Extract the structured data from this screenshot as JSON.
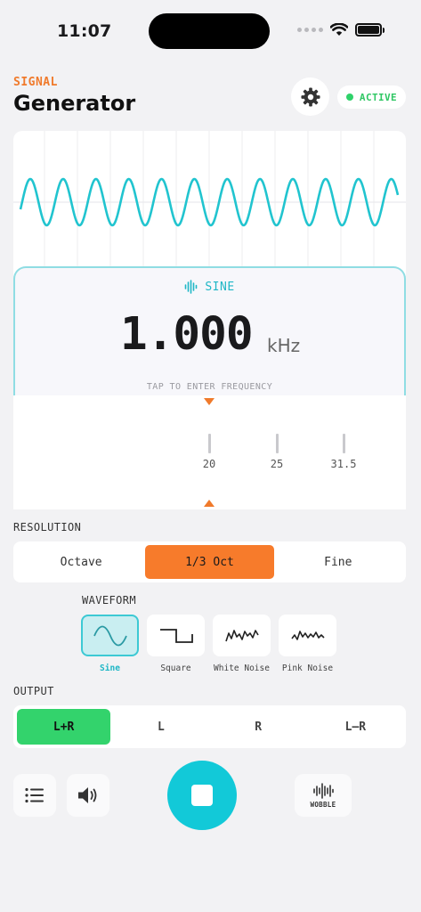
{
  "status": {
    "time": "11:07"
  },
  "header": {
    "kicker": "SIGNAL",
    "title": "Generator",
    "badge": "ACTIVE",
    "settings_icon": "gear-icon"
  },
  "colors": {
    "accent_orange": "#f07a2b",
    "accent_cyan": "#1fb7c6",
    "active_green": "#33d36c"
  },
  "oscilloscope": {
    "waveform": "sine",
    "cycles": 11.5
  },
  "frequency": {
    "wave_type": "SINE",
    "value": "1.000",
    "unit": "kHz",
    "hint": "TAP TO ENTER FREQUENCY"
  },
  "ruler": {
    "ticks": [
      "20",
      "25",
      "31.5"
    ]
  },
  "resolution": {
    "label": "RESOLUTION",
    "options": [
      "Octave",
      "1/3 Oct",
      "Fine"
    ],
    "selected": "1/3 Oct"
  },
  "waveform": {
    "label": "WAVEFORM",
    "options": [
      "Sine",
      "Square",
      "White Noise",
      "Pink Noise"
    ],
    "selected": "Sine"
  },
  "output": {
    "label": "OUTPUT",
    "options": [
      "L+R",
      "L",
      "R",
      "L–R"
    ],
    "selected": "L+R"
  },
  "controls": {
    "wobble_label": "WOBBLE",
    "list_icon": "list-icon",
    "speaker_icon": "speaker-icon",
    "stop_icon": "stop-icon"
  }
}
